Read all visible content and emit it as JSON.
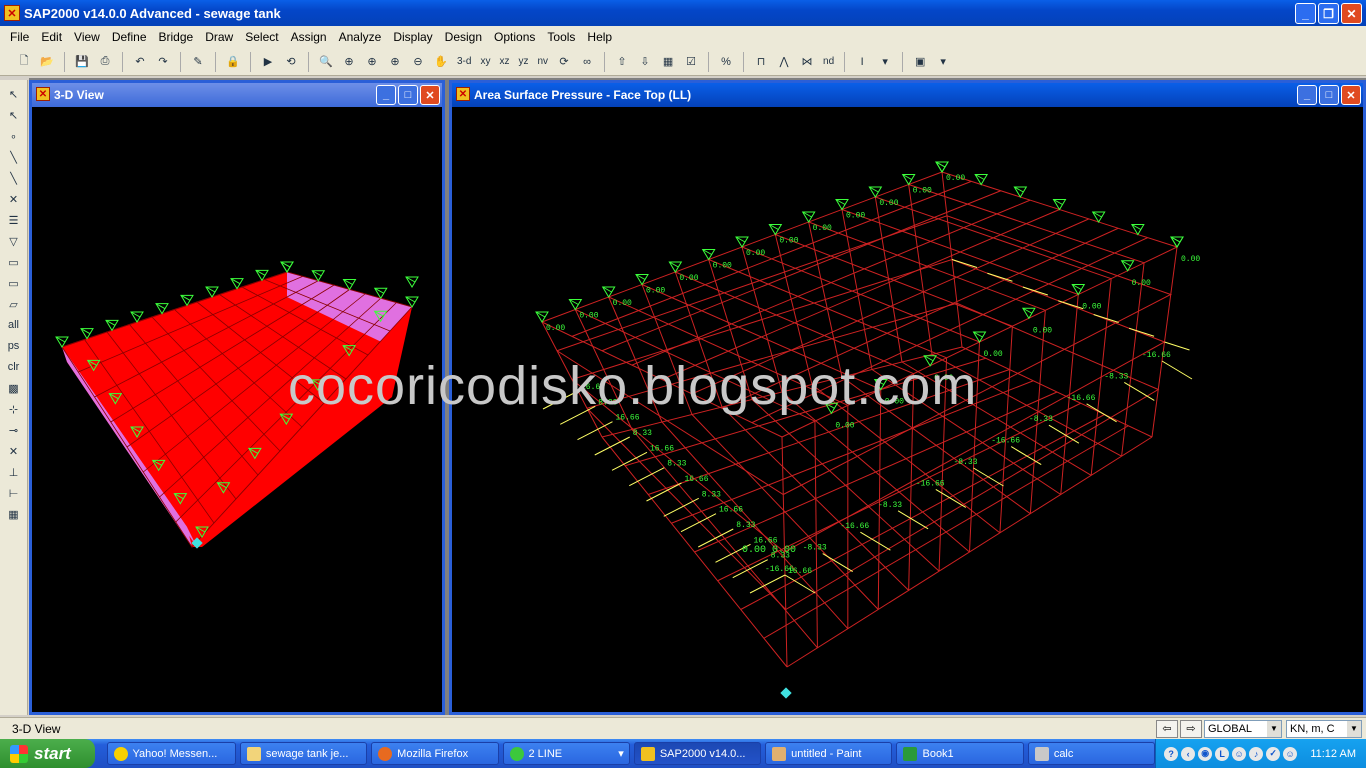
{
  "app": {
    "title": "SAP2000 v14.0.0 Advanced  - sewage tank",
    "window_buttons": [
      "minimize-icon",
      "restore-icon",
      "close-icon"
    ]
  },
  "menu": [
    "File",
    "Edit",
    "View",
    "Define",
    "Bridge",
    "Draw",
    "Select",
    "Assign",
    "Analyze",
    "Display",
    "Design",
    "Options",
    "Tools",
    "Help"
  ],
  "toolbar": {
    "view_labels": [
      "3-d",
      "xy",
      "xz",
      "yz",
      "nv"
    ],
    "nd_label": "nd"
  },
  "left_toolbar": {
    "labels": [
      "all",
      "ps",
      "clr"
    ]
  },
  "panes": {
    "left": {
      "title": "3-D View"
    },
    "right": {
      "title": "Area Surface Pressure - Face Top  (LL)"
    }
  },
  "drawing": {
    "pressure_labels": [
      "0.00",
      "8.33",
      "16.66",
      "-8.33",
      "-16.66",
      "0.00 0.00"
    ],
    "colors": {
      "tank_fill": "#ff0000",
      "tank_side": "#e070e0",
      "mesh": "#cc2222",
      "text": "#3cff3c",
      "arrows": "#ffff66"
    }
  },
  "watermark": "cocoricodisko.blogspot.com",
  "status": {
    "text": "3-D View",
    "coord_system": "GLOBAL",
    "units": "KN, m, C"
  },
  "taskbar": {
    "start_label": "start",
    "tasks": [
      "Yahoo! Messen...",
      "sewage tank je...",
      "Mozilla Firefox",
      "2 LINE",
      "SAP2000 v14.0...",
      "untitled - Paint",
      "Book1",
      "calc"
    ],
    "clock": "11:12 AM"
  }
}
